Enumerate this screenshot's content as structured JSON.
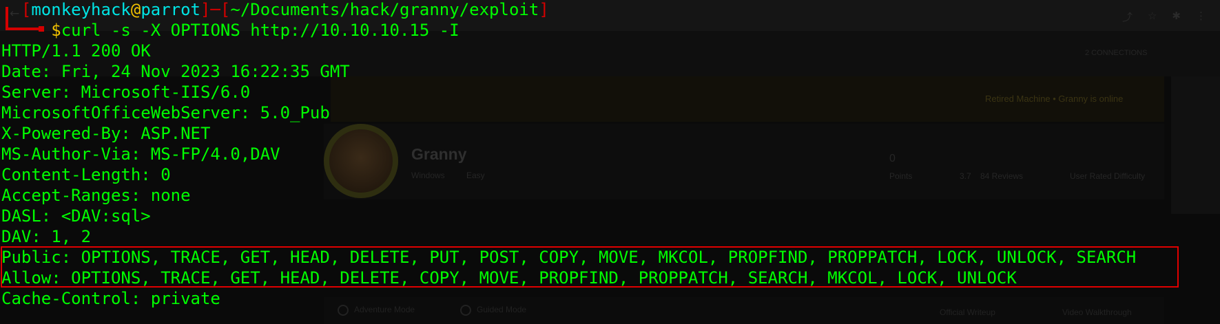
{
  "prompt": {
    "open_bracket": "┌─[",
    "user": "monkeyhack",
    "at": "@",
    "host": "parrot",
    "separator": "]─[",
    "path": "~/Documents/hack/granny/exploit",
    "close_bracket": "]"
  },
  "command": {
    "symbol": "$",
    "text": "curl -s -X OPTIONS http://10.10.10.15 -I"
  },
  "response_lines": [
    "HTTP/1.1 200 OK",
    "Date: Fri, 24 Nov 2023 16:22:35 GMT",
    "Server: Microsoft-IIS/6.0",
    "MicrosoftOfficeWebServer: 5.0_Pub",
    "X-Powered-By: ASP.NET",
    "MS-Author-Via: MS-FP/4.0,DAV",
    "Content-Length: 0",
    "Accept-Ranges: none",
    "DASL: <DAV:sql>",
    "DAV: 1, 2",
    "Public: OPTIONS, TRACE, GET, HEAD, DELETE, PUT, POST, COPY, MOVE, MKCOL, PROPFIND, PROPPATCH, LOCK, UNLOCK, SEARCH",
    "Allow: OPTIONS, TRACE, GET, HEAD, DELETE, COPY, MOVE, PROPFIND, PROPPATCH, SEARCH, MKCOL, LOCK, UNLOCK",
    "Cache-Control: private"
  ],
  "highlighted_lines": [
    10,
    11
  ],
  "background_page": {
    "machine_name": "Granny",
    "os": "Windows",
    "difficulty": "Easy",
    "points_value": "0",
    "points_label": "Points",
    "rating": "3.7",
    "reviews": "84 Reviews",
    "user_difficulty": "User Rated Difficulty",
    "banner": "Retired Machine • Granny is online",
    "adventure_mode": "Adventure Mode",
    "guided_mode": "Guided Mode",
    "official_writeup": "Official Writeup",
    "video_walkthrough": "Video Walkthrough",
    "connections": "2 CONNECTIONS"
  },
  "colors": {
    "terminal_bg": "#0a0a0a",
    "text": "#00ff00",
    "prompt_red": "#d40000",
    "prompt_cyan": "#00e5e5",
    "prompt_yellow": "#f2c200",
    "highlight_border": "#e00000"
  }
}
